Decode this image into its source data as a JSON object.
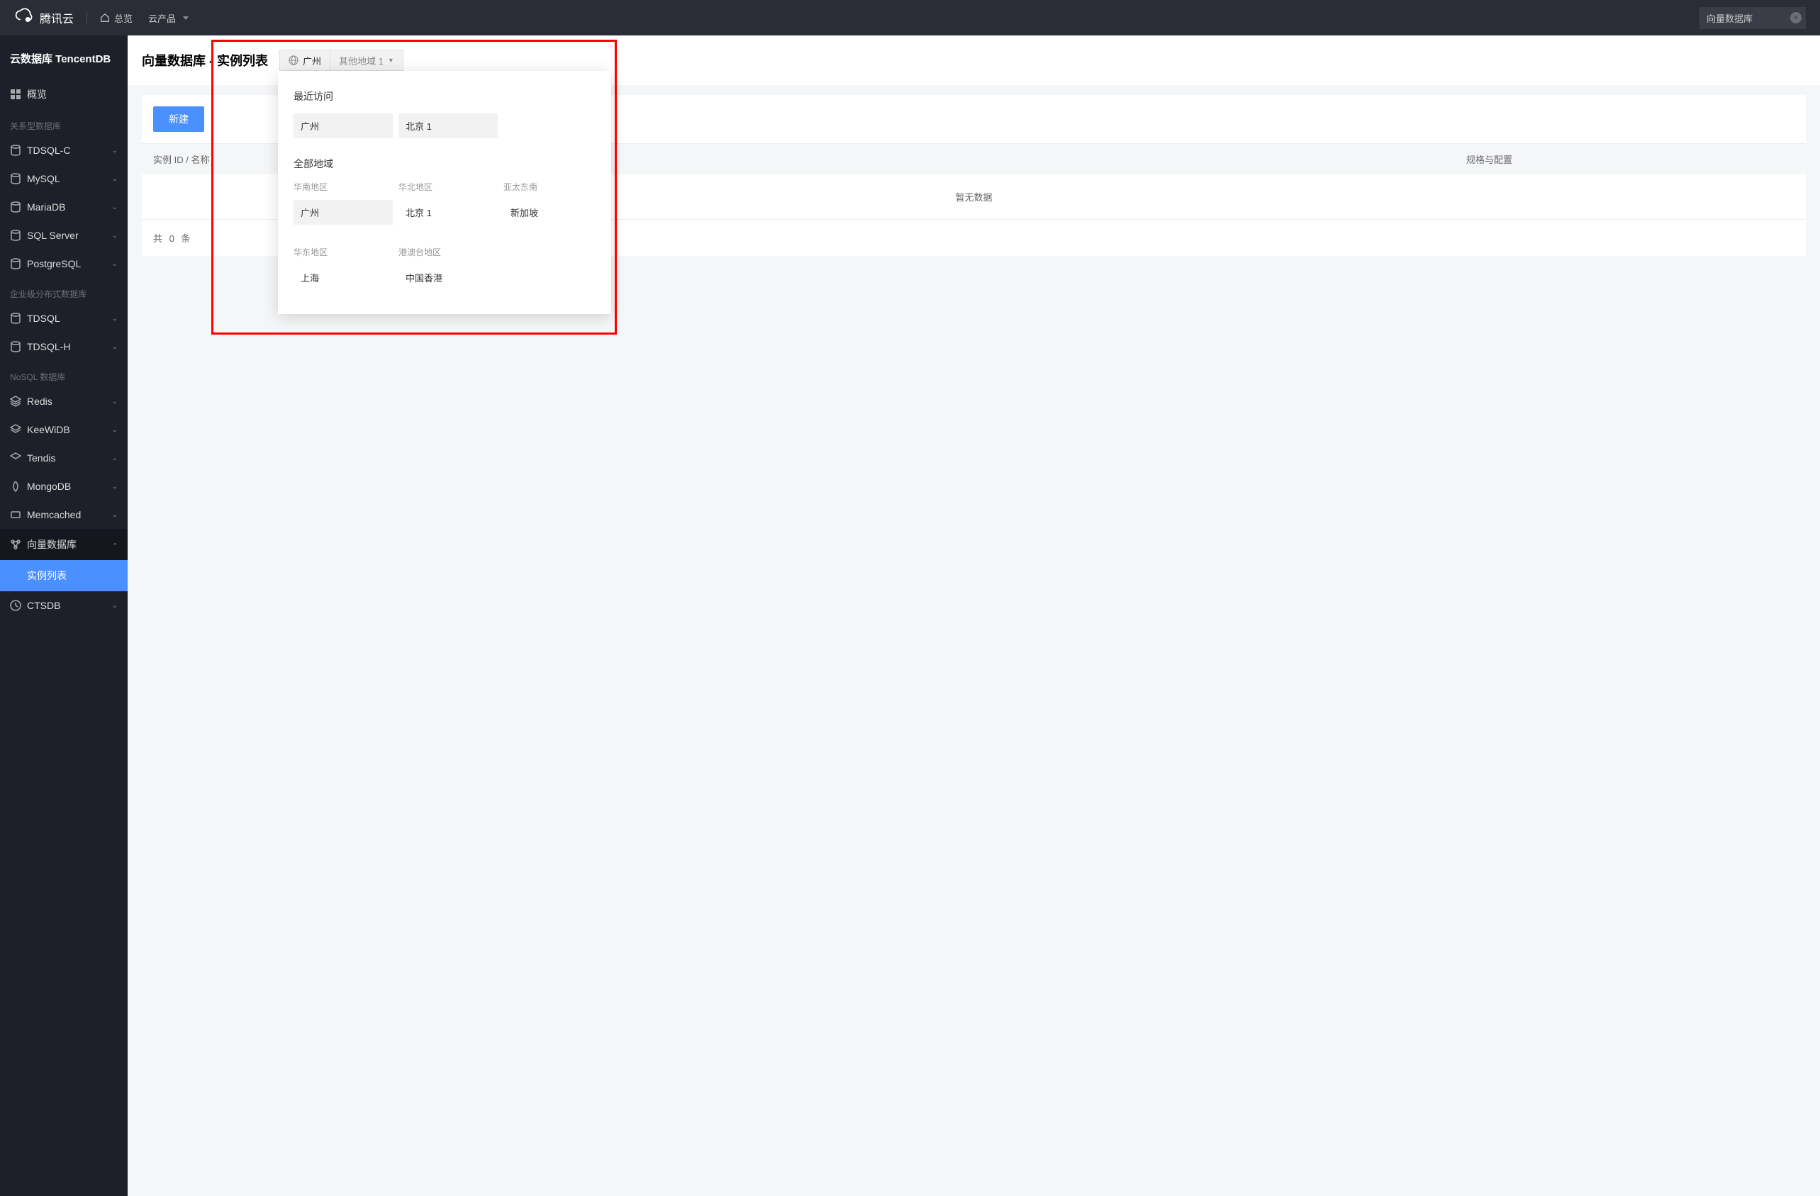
{
  "topbar": {
    "brand": "腾讯云",
    "overview": "总览",
    "products": "云产品",
    "search_value": "向量数据库"
  },
  "sidebar": {
    "title": "云数据库 TencentDB",
    "overview": "概览",
    "groups": [
      {
        "label": "关系型数据库",
        "items": [
          "TDSQL-C",
          "MySQL",
          "MariaDB",
          "SQL Server",
          "PostgreSQL"
        ]
      },
      {
        "label": "企业级分布式数据库",
        "items": [
          "TDSQL",
          "TDSQL-H"
        ]
      },
      {
        "label": "NoSQL 数据库",
        "items": [
          "Redis",
          "KeeWiDB",
          "Tendis",
          "MongoDB",
          "Memcached",
          "向量数据库",
          "CTSDB"
        ]
      }
    ],
    "active_sub": "实例列表"
  },
  "page": {
    "title": "向量数据库 - 实例列表",
    "region_current": "广州",
    "region_other": "其他地域 1",
    "new_button": "新建",
    "table": {
      "col_id": "实例 ID / 名称",
      "col_spec": "规格与配置",
      "empty": "暂无数据",
      "footer_prefix": "共",
      "footer_count": "0",
      "footer_suffix": "条"
    }
  },
  "popover": {
    "recent_title": "最近访问",
    "recent": [
      "广州",
      "北京 1"
    ],
    "all_title": "全部地域",
    "cols": [
      {
        "title": "华南地区",
        "items": [
          "广州"
        ]
      },
      {
        "title": "华北地区",
        "items": [
          "北京 1"
        ]
      },
      {
        "title": "亚太东南",
        "items": [
          "新加坡"
        ]
      }
    ],
    "cols2": [
      {
        "title": "华东地区",
        "items": [
          "上海"
        ]
      },
      {
        "title": "港澳台地区",
        "items": [
          "中国香港"
        ]
      },
      {
        "title": "",
        "items": []
      }
    ]
  }
}
